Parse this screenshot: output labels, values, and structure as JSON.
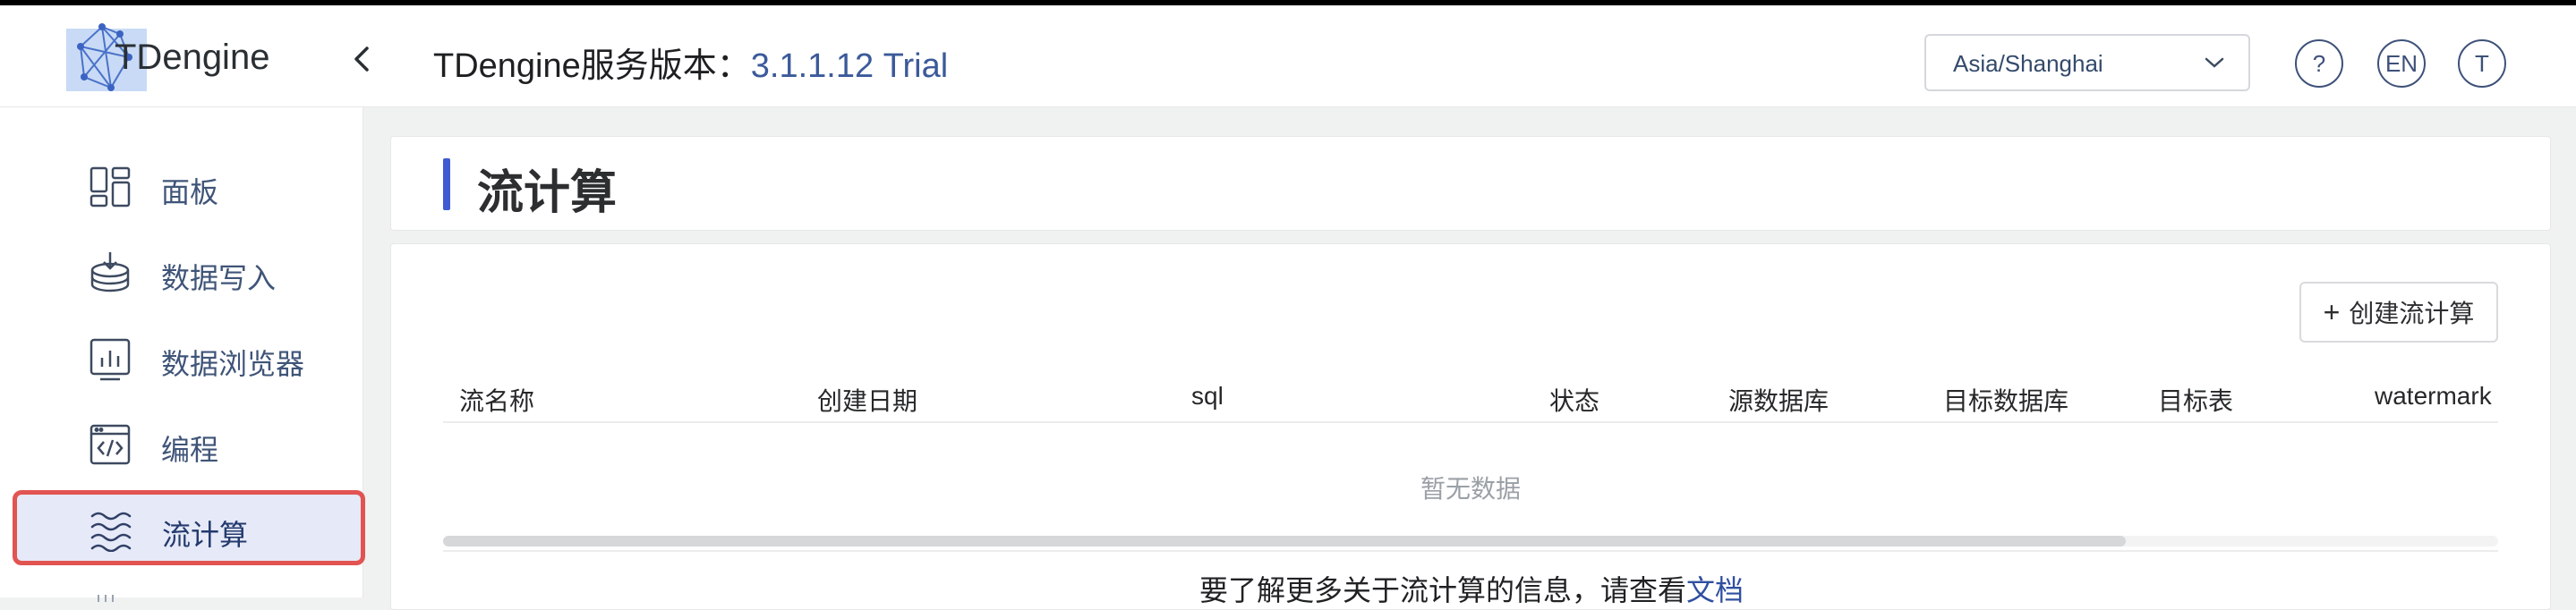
{
  "header": {
    "logo_text": "TDengine",
    "version_prefix": "TDengine服务版本：",
    "version": "3.1.1.12 Trial",
    "timezone": "Asia/Shanghai",
    "help_label": "?",
    "lang_label": "EN",
    "user_label": "T"
  },
  "sidebar": {
    "items": [
      {
        "label": "面板",
        "icon": "dashboard-icon"
      },
      {
        "label": "数据写入",
        "icon": "data-ingest-icon"
      },
      {
        "label": "数据浏览器",
        "icon": "data-browser-icon"
      },
      {
        "label": "编程",
        "icon": "code-icon"
      },
      {
        "label": "流计算",
        "icon": "stream-icon",
        "active": true
      }
    ]
  },
  "page": {
    "title": "流计算",
    "create_button": "创建流计算",
    "table": {
      "columns": [
        "流名称",
        "创建日期",
        "sql",
        "状态",
        "源数据库",
        "目标数据库",
        "目标表",
        "watermark"
      ],
      "rows": [],
      "empty_text": "暂无数据"
    },
    "footer_prefix": "要了解更多关于流计算的信息，请查看",
    "footer_link": "文档"
  },
  "colors": {
    "accent": "#3e5bd1",
    "active_bg": "#e6e9f7",
    "highlight_border": "#e15452",
    "nav_text": "#3f5478"
  }
}
